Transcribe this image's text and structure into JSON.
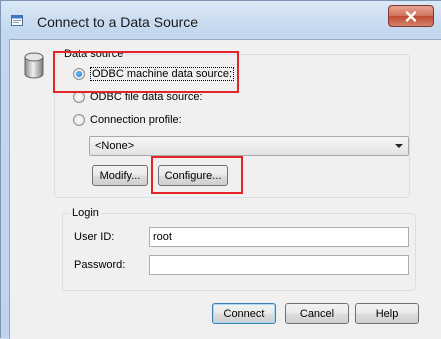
{
  "window": {
    "title": "Connect to a Data Source"
  },
  "data_source": {
    "legend": "Data source",
    "options": [
      {
        "label": "ODBC machine data source:",
        "checked": true
      },
      {
        "label": "ODBC file data source:",
        "checked": false
      },
      {
        "label": "Connection profile:",
        "checked": false
      }
    ],
    "profile_select": {
      "value": "<None>"
    },
    "modify_label": "Modify...",
    "configure_label": "Configure..."
  },
  "login": {
    "legend": "Login",
    "user_id_label": "User ID:",
    "user_id_value": "root",
    "password_label": "Password:",
    "password_value": ""
  },
  "footer": {
    "connect_label": "Connect",
    "cancel_label": "Cancel",
    "help_label": "Help"
  },
  "annotation_color": "#e5242a",
  "icons": {
    "title": "window-icon",
    "close": "close-icon",
    "database": "database-icon"
  }
}
